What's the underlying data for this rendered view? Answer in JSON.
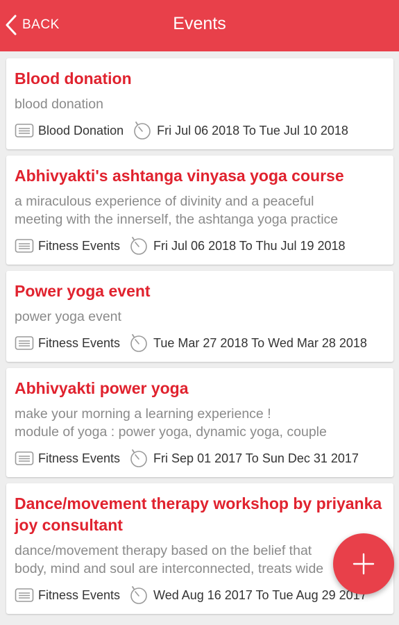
{
  "appbar": {
    "back_label": "BACK",
    "title": "Events"
  },
  "colors": {
    "primary": "#e8404a",
    "title_text": "#e0222e"
  },
  "icons": {
    "back": "chevron-left-icon",
    "category": "tag-list-icon",
    "date": "timer-icon",
    "fab": "plus-icon"
  },
  "events": [
    {
      "title": "Blood donation",
      "description": "blood donation",
      "category": "Blood Donation",
      "dates": "Fri Jul 06 2018  To Tue Jul 10 2018"
    },
    {
      "title": "Abhivyakti's ashtanga vinyasa yoga course",
      "description": "a miraculous experience of divinity and a peaceful\nmeeting with the innerself, the ashtanga yoga practice",
      "category": "Fitness Events",
      "dates": "Fri Jul 06 2018  To Thu Jul 19 2018"
    },
    {
      "title": "Power yoga event",
      "description": "power yoga event",
      "category": "Fitness Events",
      "dates": "Tue Mar 27 2018  To Wed Mar 28 2018"
    },
    {
      "title": "Abhivyakti power yoga",
      "description": "make your morning a learning experience !\nmodule of yoga : power yoga, dynamic yoga, couple",
      "category": "Fitness Events",
      "dates": "Fri Sep 01 2017  To Sun Dec 31 2017"
    },
    {
      "title": "Dance/movement therapy workshop by priyanka joy consultant",
      "description": "dance/movement therapy based on the belief that\nbody, mind and soul are interconnected, treats wide",
      "category": "Fitness Events",
      "dates": "Wed Aug 16 2017  To Tue Aug 29 2017"
    }
  ]
}
